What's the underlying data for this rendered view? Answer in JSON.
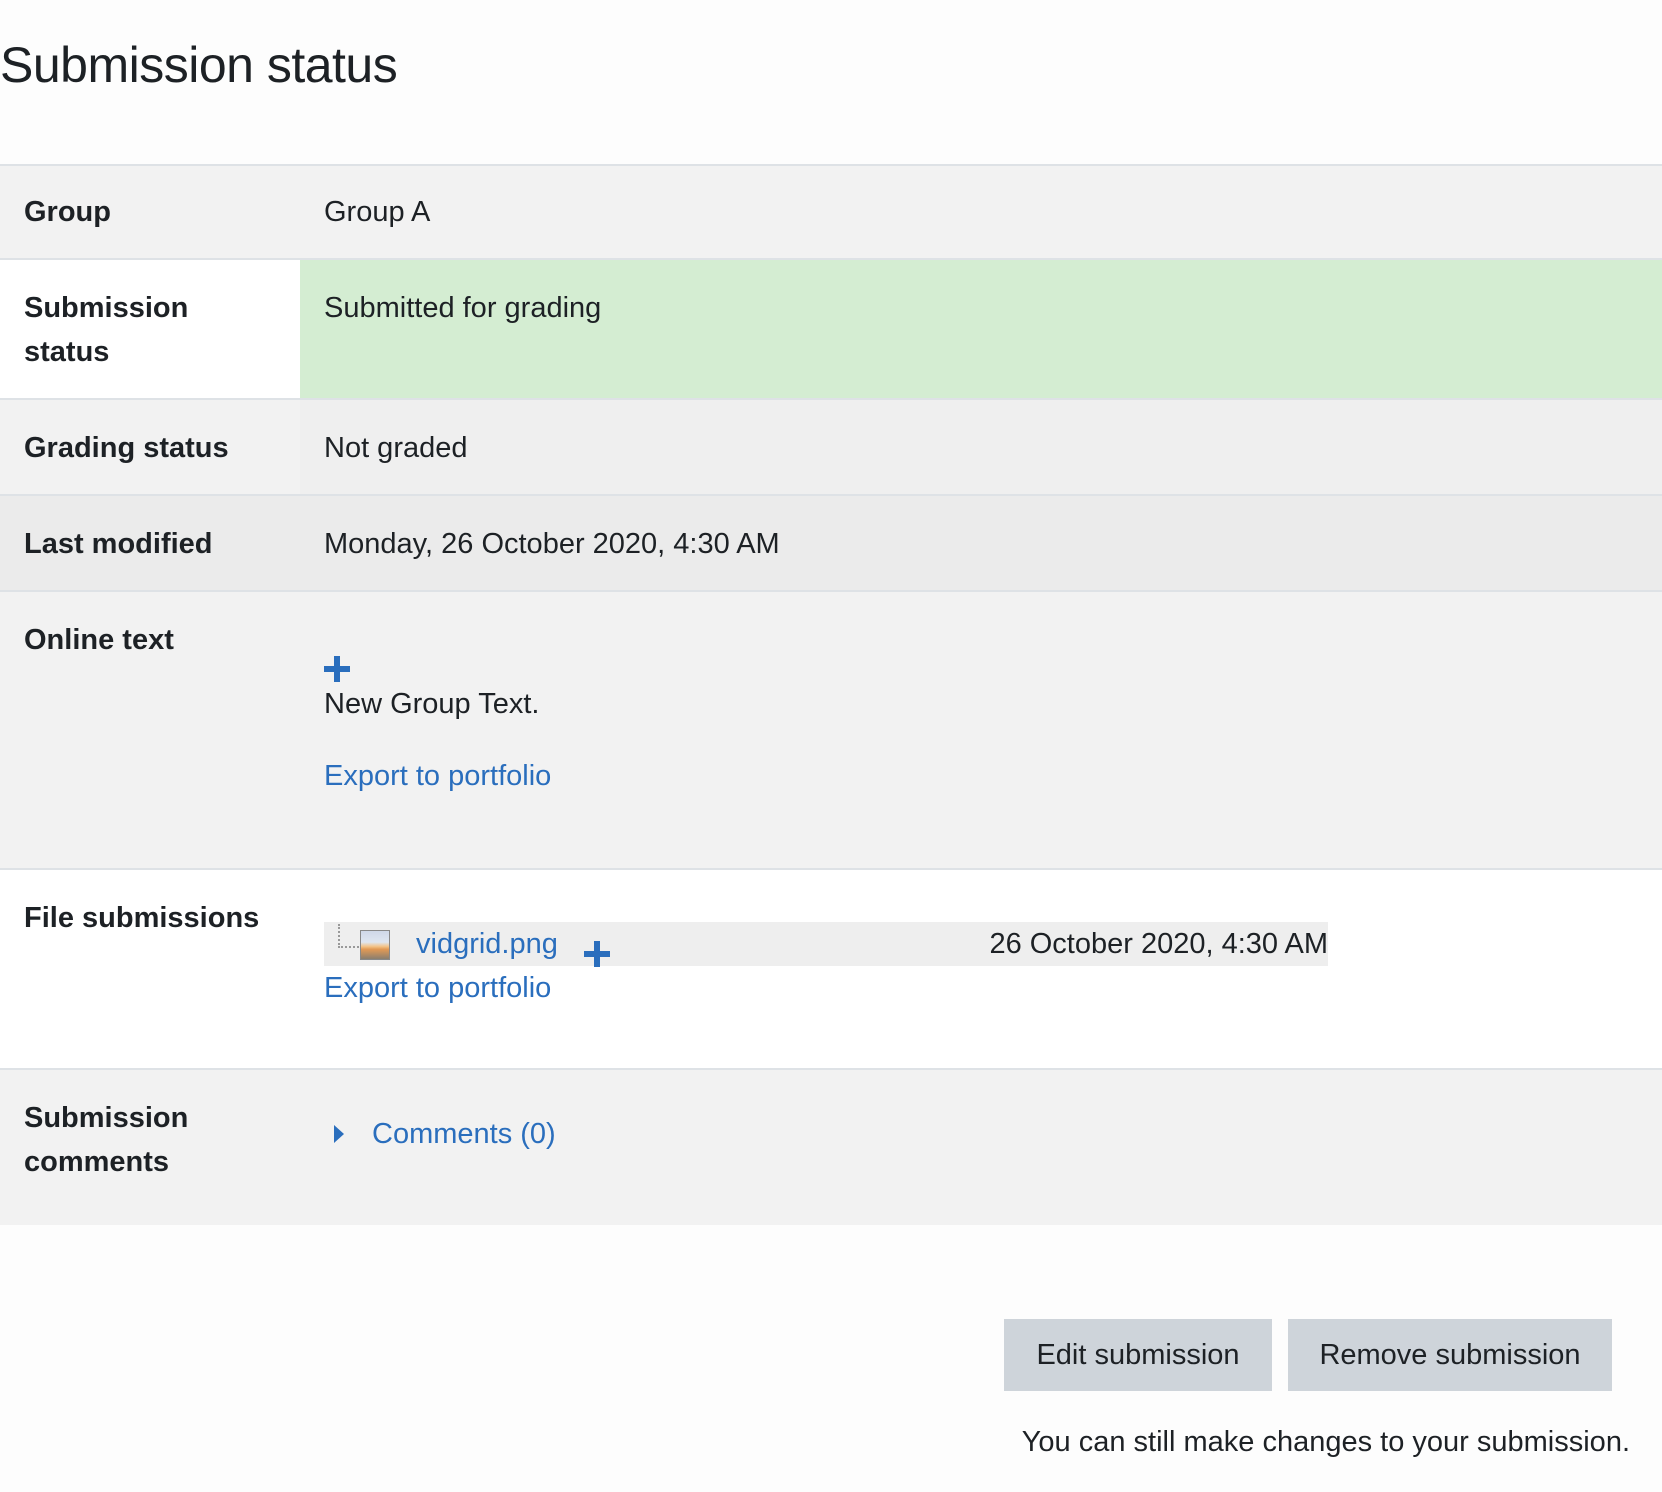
{
  "page_title": "Submission status",
  "rows": {
    "group": {
      "label": "Group",
      "value": "Group A"
    },
    "submission_status": {
      "label": "Submission status",
      "value": "Submitted for grading"
    },
    "grading_status": {
      "label": "Grading status",
      "value": "Not graded"
    },
    "last_modified": {
      "label": "Last modified",
      "value": "Monday, 26 October 2020, 4:30 AM"
    },
    "online_text": {
      "label": "Online text",
      "text": "New Group Text.",
      "export_link": "Export to portfolio"
    },
    "file_submissions": {
      "label": "File submissions",
      "file": {
        "name": "vidgrid.png",
        "date": "26 October 2020, 4:30 AM"
      },
      "export_link": "Export to portfolio"
    },
    "submission_comments": {
      "label": "Submission comments",
      "link": "Comments (0)"
    }
  },
  "buttons": {
    "edit": "Edit submission",
    "remove": "Remove submission"
  },
  "note": "You can still make changes to your submission.",
  "colors": {
    "link": "#2a6ebd",
    "submitted_bg": "#d4edd2",
    "button_bg": "#ced4da"
  },
  "icons": [
    "plus-icon",
    "tree-icon",
    "image-file-icon",
    "caret-right-icon"
  ]
}
